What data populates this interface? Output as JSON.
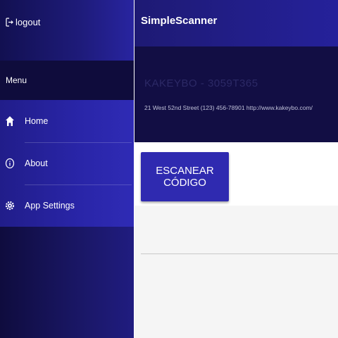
{
  "sidebar": {
    "logout_label": "logout",
    "menu_header": "Menu",
    "items": [
      {
        "label": "Home",
        "icon": "home-icon"
      },
      {
        "label": "About",
        "icon": "info-icon"
      },
      {
        "label": "App Settings",
        "icon": "settings-icon"
      }
    ]
  },
  "toolbar": {
    "title": "SimpleScanner"
  },
  "card": {
    "company": "KAKEYBO - 3059T365",
    "address": "21 West 52nd Street (123) 456-78901 http://www.kakeybo.com/"
  },
  "scan": {
    "button_label": "ESCANEAR CÓDIGO"
  },
  "colors": {
    "primary": "#2f2ab0",
    "dark": "#120e44",
    "menu_header": "#0f0c3c"
  }
}
